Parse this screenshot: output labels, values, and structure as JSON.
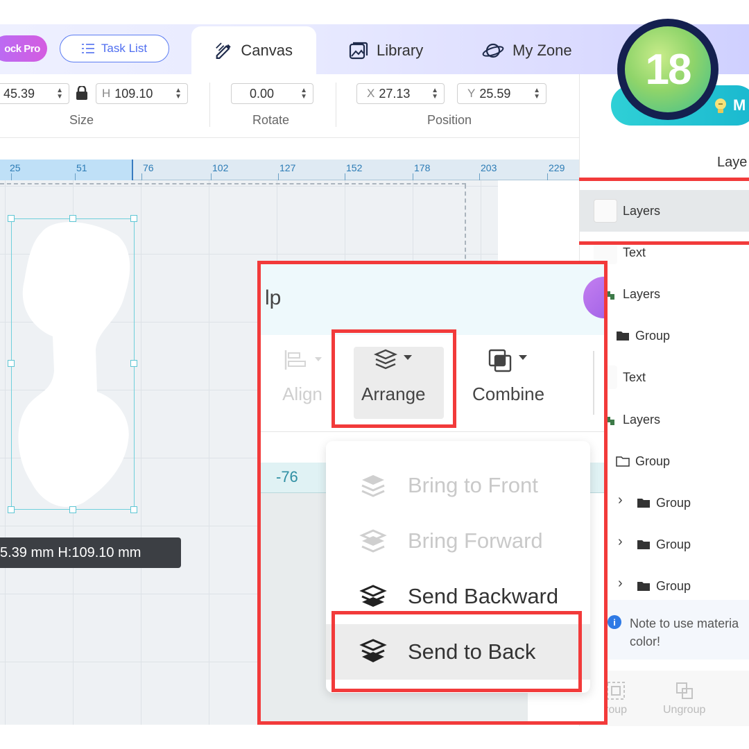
{
  "top_bar": {
    "unlock_label": "ock Pro",
    "task_list_label": "Task List",
    "tabs": [
      {
        "label": "Canvas",
        "active": true
      },
      {
        "label": "Library",
        "active": false
      },
      {
        "label": "My Zone",
        "active": false
      }
    ]
  },
  "step_badge": {
    "number": "18"
  },
  "properties": {
    "size": {
      "width": "45.39",
      "height_prefix": "H",
      "height": "109.10",
      "label": "Size"
    },
    "rotate": {
      "value": "0.00",
      "label": "Rotate"
    },
    "position": {
      "x_prefix": "X",
      "x": "27.13",
      "y_prefix": "Y",
      "y": "25.59",
      "label": "Position"
    }
  },
  "ruler": {
    "ticks": [
      "25",
      "51",
      "76",
      "102",
      "127",
      "152",
      "178",
      "203",
      "229"
    ]
  },
  "size_tooltip": "5.39 mm  H:109.10 mm",
  "right_panel": {
    "make_button_label": "M",
    "title": "Laye",
    "layers": [
      {
        "label": "Layers",
        "kind": "layer",
        "selected": true
      },
      {
        "label": "Text",
        "kind": "text"
      },
      {
        "label": "Layers",
        "kind": "layer"
      },
      {
        "label": "Group",
        "kind": "group-filled"
      },
      {
        "label": "Text",
        "kind": "text"
      },
      {
        "label": "Layers",
        "kind": "layer"
      },
      {
        "label": "Group",
        "kind": "group-outline"
      },
      {
        "label": "Group",
        "kind": "group-collapsed"
      },
      {
        "label": "Group",
        "kind": "group-collapsed"
      },
      {
        "label": "Group",
        "kind": "group-collapsed"
      }
    ],
    "note": "Note to use materia color!",
    "note_line1": "Note to use materia",
    "note_line2": "color!",
    "bottom_tools": {
      "group": "roup",
      "ungroup": "Ungroup"
    }
  },
  "popup": {
    "header_text": "lp",
    "toolbar": {
      "align": "Align",
      "arrange": "Arrange",
      "combine": "Combine"
    },
    "ruler_text": "-76",
    "menu": [
      {
        "label": "Bring to Front",
        "enabled": false
      },
      {
        "label": "Bring Forward",
        "enabled": false
      },
      {
        "label": "Send Backward",
        "enabled": true
      },
      {
        "label": "Send to Back",
        "enabled": true,
        "highlighted": true
      }
    ]
  },
  "colors": {
    "highlight_red": "#f23a3a",
    "accent_blue": "#4f6ef0",
    "make_button": "#1ab8cf",
    "badge_ring": "#14204f"
  }
}
